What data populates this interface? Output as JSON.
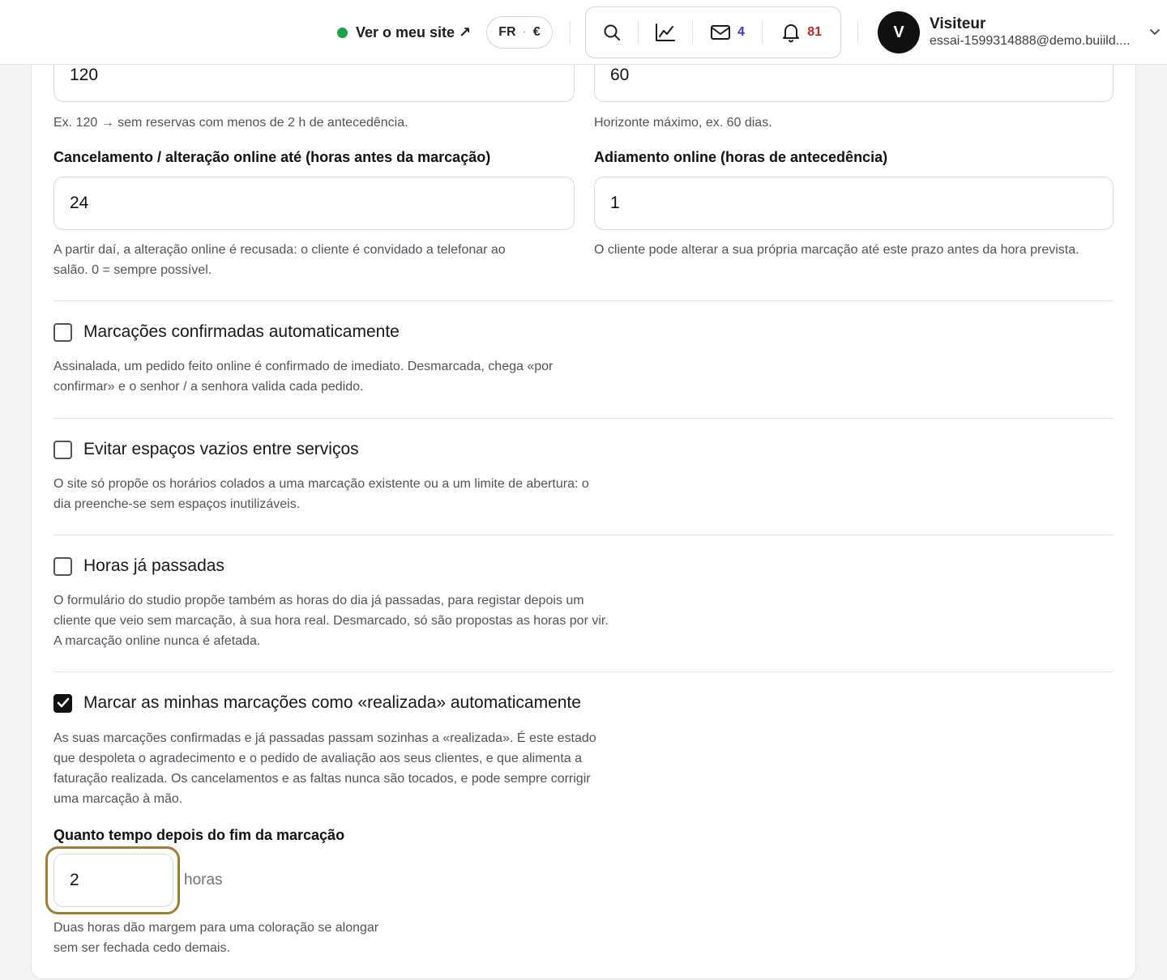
{
  "header": {
    "site_link": "Ver o meu site ↗",
    "lang": "FR",
    "currency": "€",
    "messages_count": "4",
    "notifications_count": "81",
    "user": {
      "initial": "V",
      "name": "Visiteur",
      "email": "essai-1599314888@demo.buiild...."
    }
  },
  "form": {
    "min_notice": {
      "value": "120",
      "help": "Ex. 120 → sem reservas com menos de 2 h de antecedência."
    },
    "max_horizon": {
      "value": "60",
      "help": "Horizonte máximo, ex. 60 dias."
    },
    "cancel_until": {
      "label": "Cancelamento / alteração online até (horas antes da marcação)",
      "value": "24",
      "help_line1": "A partir daí, a alteração online é recusada: o cliente é convidado a telefonar ao",
      "help_line2": "salão. 0 = sempre possível."
    },
    "postpone": {
      "label": "Adiamento online (horas de antecedência)",
      "value": "1",
      "help": "O cliente pode alterar a sua própria marcação até este prazo antes da hora prevista."
    },
    "auto_confirm": {
      "label": "Marcações confirmadas automaticamente",
      "checked": false,
      "help_line1": "Assinalada, um pedido feito online é confirmado de imediato. Desmarcada, chega «por",
      "help_line2": "confirmar» e o senhor / a senhora valida cada pedido."
    },
    "avoid_gaps": {
      "label": "Evitar espaços vazios entre serviços",
      "checked": false,
      "help_line1": "O site só propõe os horários colados a uma marcação existente ou a um limite de abertura: o",
      "help_line2": "dia preenche-se sem espaços inutilizáveis."
    },
    "past_hours": {
      "label": "Horas já passadas",
      "checked": false,
      "help_line1": "O formulário do studio propõe também as horas do dia já passadas, para registar depois um",
      "help_line2": "cliente que veio sem marcação, à sua hora real. Desmarcado, só são propostas as horas por vir.",
      "help_line3": "A marcação online nunca é afetada."
    },
    "auto_done": {
      "label": "Marcar as minhas marcações como «realizada» automaticamente",
      "checked": true,
      "help_line1": "As suas marcações confirmadas e já passadas passam sozinhas a «realizada». É este estado",
      "help_line2": "que despoleta o agradecimento e o pedido de avaliação aos seus clientes, e que alimenta a",
      "help_line3": "faturação realizada. Os cancelamentos e as faltas nunca são tocados, e pode sempre corrigir",
      "help_line4": "uma marcação à mão."
    },
    "delay_after": {
      "label": "Quanto tempo depois do fim da marcação",
      "value": "2",
      "unit": "horas",
      "help_line1": "Duas horas dão margem para uma coloração se alongar",
      "help_line2": "sem ser fechada cedo demais."
    }
  },
  "colors": {
    "accent_focus": "#a07c35",
    "online_dot": "#16a34a",
    "messages_badge": "#3b38d6",
    "notifications_badge": "#c62828"
  }
}
